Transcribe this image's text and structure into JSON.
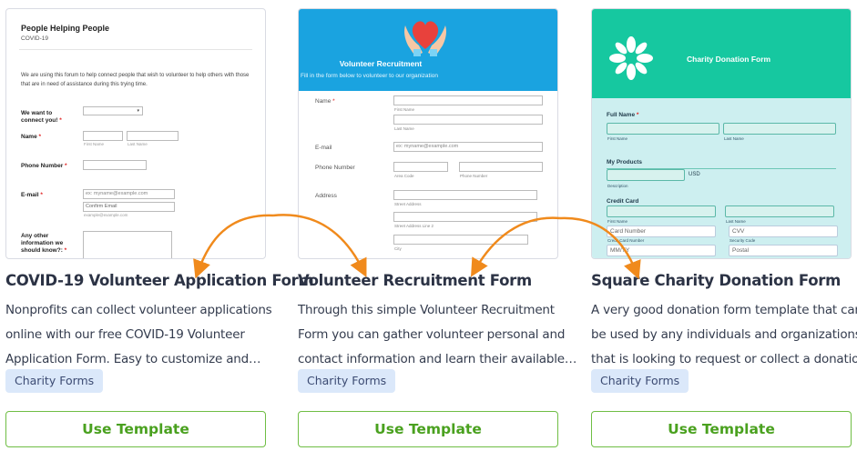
{
  "cards": [
    {
      "title": "COVID-19 Volunteer Application Form",
      "desc": [
        "Nonprofits can collect volunteer applications",
        "online with our free COVID-19 Volunteer",
        "Application Form. Easy to customize and…"
      ],
      "tag": "Charity Forms",
      "button": "Use Template",
      "preview": {
        "heading": "People Helping People",
        "subheading": "COVID-19",
        "intro": "We are using this forum to help connect people that wish to volunteer to help others with those that are in need of assistance during this trying time.",
        "q1": "We want to connect you!",
        "name": "Name",
        "first": "First Name",
        "last": "Last Name",
        "phone": "Phone Number",
        "email": "E-mail",
        "email_placeholder": "ex: myname@example.com",
        "confirm": "Confirm Email",
        "example": "example@example.com",
        "other": "Any other information we should know?:",
        "req": "*"
      }
    },
    {
      "title": "Volunteer Recruitment Form",
      "desc": [
        "Through this simple Volunteer Recruitment",
        "Form you can gather volunteer personal and",
        "contact information and learn their available…"
      ],
      "tag": "Charity Forms",
      "button": "Use Template",
      "preview": {
        "heading": "Volunteer Recruitment",
        "subheading": "Fill in the form below to volunteer to our organization",
        "name": "Name",
        "first": "First Name",
        "last": "Last Name",
        "email": "E-mail",
        "email_placeholder": "ex: myname@example.com",
        "phone": "Phone Number",
        "area": "Area Code",
        "phone_cap": "Phone Number",
        "address": "Address",
        "street": "Street Address",
        "street2": "Street Address Line 2",
        "city": "City",
        "req": "*"
      }
    },
    {
      "title": "Square Charity Donation Form",
      "desc": [
        "A very good donation form template that can",
        "be used by any individuals and organizations",
        "that is looking to request or collect a donation."
      ],
      "tag": "Charity Forms",
      "button": "Use Template",
      "preview": {
        "heading": "Charity Donation Form",
        "fullname": "Full Name",
        "first": "First Name",
        "last": "Last Name",
        "products": "My Products",
        "usd": "USD",
        "description": "Description",
        "credit": "Credit Card",
        "card_number": "Card Number",
        "cvv": "CVV",
        "card_caption": "Credit Card Number",
        "security": "Security Code",
        "expiry": "MM/YY",
        "postal": "Postal",
        "req": "*"
      }
    }
  ],
  "colors": {
    "accent_green": "#4aa11f",
    "arrow_orange": "#f08a1c",
    "tag_bg": "#dbe8fa",
    "blue_header": "#1aa3e0",
    "teal_header": "#16c8a0"
  }
}
